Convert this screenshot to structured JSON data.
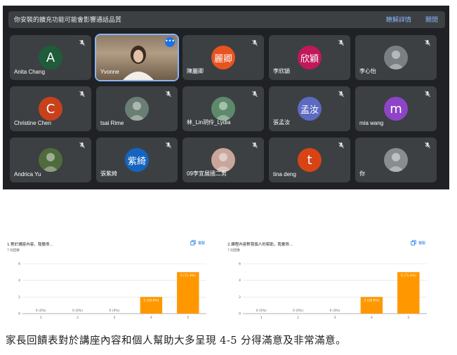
{
  "banner": {
    "text": "你安裝的擴充功能可能會影響通話品質",
    "details": "瞭解詳情",
    "close": "關閉"
  },
  "participants": [
    {
      "name": "Anita Chang",
      "avatar_type": "letter",
      "avatar_text": "A",
      "color": "#1e5c3a",
      "muted": true
    },
    {
      "name": "Yvonne",
      "avatar_type": "video",
      "avatar_text": "",
      "color": "",
      "muted": false,
      "speaking": true
    },
    {
      "name": "陳麗卿",
      "avatar_type": "cjk",
      "avatar_text": "麗卿",
      "color": "#e8531f",
      "muted": true
    },
    {
      "name": "李欣穎",
      "avatar_type": "cjk",
      "avatar_text": "欣穎",
      "color": "#c2185b",
      "muted": true
    },
    {
      "name": "李心怡",
      "avatar_type": "photo",
      "avatar_text": "",
      "color": "#7a7f84",
      "muted": true
    },
    {
      "name": "Christine Chen",
      "avatar_type": "letter",
      "avatar_text": "C",
      "color": "#c9401c",
      "muted": true
    },
    {
      "name": "tsai Rime",
      "avatar_type": "photo",
      "avatar_text": "",
      "color": "#6b7e74",
      "muted": true
    },
    {
      "name": "林_Lin玥伶_Lydia",
      "avatar_type": "photo",
      "avatar_text": "",
      "color": "#5e8a6b",
      "muted": true
    },
    {
      "name": "張孟汝",
      "avatar_type": "cjk",
      "avatar_text": "孟汝",
      "color": "#5c6bc0",
      "muted": true
    },
    {
      "name": "mia wang",
      "avatar_type": "letter",
      "avatar_text": "m",
      "color": "#8e44c7",
      "muted": true
    },
    {
      "name": "Andrica Yu",
      "avatar_type": "photo",
      "avatar_text": "",
      "color": "#4f6b3c",
      "muted": true
    },
    {
      "name": "張紫綺",
      "avatar_type": "cjk",
      "avatar_text": "紫綺",
      "color": "#1565c0",
      "muted": true
    },
    {
      "name": "09李宜展國二男",
      "avatar_type": "photo",
      "avatar_text": "",
      "color": "#c9a69b",
      "muted": true
    },
    {
      "name": "tina deng",
      "avatar_type": "letter",
      "avatar_text": "t",
      "color": "#d84315",
      "muted": true
    },
    {
      "name": "你",
      "avatar_type": "photo",
      "avatar_text": "",
      "color": "#8a8d90",
      "muted": true
    }
  ],
  "chart_data": [
    {
      "type": "bar",
      "title": "1.對於講座內容，我覺得...",
      "subtitle": "7 則回應",
      "copy_label": "複製",
      "categories": [
        "1",
        "2",
        "3",
        "4",
        "5"
      ],
      "values": [
        0,
        0,
        0,
        2,
        5
      ],
      "data_labels": [
        "0 (0%)",
        "0 (0%)",
        "0 (0%)",
        "2 (28.6%)",
        "5 (71.4%)"
      ],
      "y_ticks": [
        "0",
        "2",
        "4",
        "6"
      ],
      "ylim": [
        0,
        6
      ],
      "bar_color": "#ff9800",
      "grid": true
    },
    {
      "type": "bar",
      "title": "2.課程內容對我個人的幫助，我覺得...",
      "subtitle": "7 則回應",
      "copy_label": "複製",
      "categories": [
        "1",
        "2",
        "3",
        "4",
        "5"
      ],
      "values": [
        0,
        0,
        0,
        2,
        5
      ],
      "data_labels": [
        "0 (0%)",
        "0 (0%)",
        "0 (0%)",
        "2 (28.6%)",
        "5 (71.4%)"
      ],
      "y_ticks": [
        "0",
        "2",
        "4",
        "6"
      ],
      "ylim": [
        0,
        6
      ],
      "bar_color": "#ff9800",
      "grid": true
    }
  ],
  "caption": "家長回饋表對於講座內容和個人幫助大多呈現 4-5 分得滿意及非常滿意。"
}
